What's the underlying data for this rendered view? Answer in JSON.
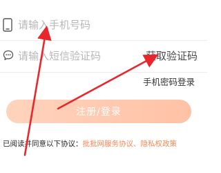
{
  "form": {
    "phone": {
      "placeholder": "请输入手机号码",
      "icon": "phone-icon"
    },
    "sms": {
      "placeholder": "请输入短信验证码",
      "icon": "chat-bubble-icon",
      "get_code_label": "获取验证码"
    },
    "password_login_label": "手机密码登录",
    "submit_label": "注册/登录"
  },
  "agreement": {
    "prefix": "已阅读并同意以下协议：",
    "service_link": "批批网服务协议",
    "separator": "、",
    "privacy_link": "隐私权政策"
  },
  "colors": {
    "button_gradient_start": "#ffd3bd",
    "button_gradient_end": "#ffc2a6",
    "link": "#f08a5b",
    "annotation_arrow": "#e8262b",
    "placeholder": "#b7b7b7"
  }
}
